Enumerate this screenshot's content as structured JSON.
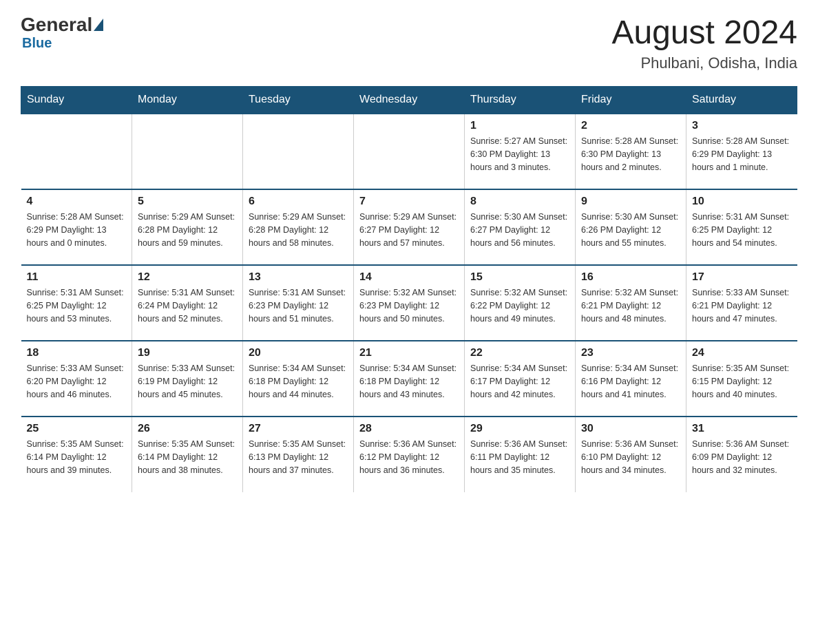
{
  "header": {
    "logo_general": "General",
    "logo_blue": "Blue",
    "month_title": "August 2024",
    "location": "Phulbani, Odisha, India"
  },
  "days_of_week": [
    "Sunday",
    "Monday",
    "Tuesday",
    "Wednesday",
    "Thursday",
    "Friday",
    "Saturday"
  ],
  "weeks": [
    [
      {
        "day": "",
        "info": ""
      },
      {
        "day": "",
        "info": ""
      },
      {
        "day": "",
        "info": ""
      },
      {
        "day": "",
        "info": ""
      },
      {
        "day": "1",
        "info": "Sunrise: 5:27 AM\nSunset: 6:30 PM\nDaylight: 13 hours\nand 3 minutes."
      },
      {
        "day": "2",
        "info": "Sunrise: 5:28 AM\nSunset: 6:30 PM\nDaylight: 13 hours\nand 2 minutes."
      },
      {
        "day": "3",
        "info": "Sunrise: 5:28 AM\nSunset: 6:29 PM\nDaylight: 13 hours\nand 1 minute."
      }
    ],
    [
      {
        "day": "4",
        "info": "Sunrise: 5:28 AM\nSunset: 6:29 PM\nDaylight: 13 hours\nand 0 minutes."
      },
      {
        "day": "5",
        "info": "Sunrise: 5:29 AM\nSunset: 6:28 PM\nDaylight: 12 hours\nand 59 minutes."
      },
      {
        "day": "6",
        "info": "Sunrise: 5:29 AM\nSunset: 6:28 PM\nDaylight: 12 hours\nand 58 minutes."
      },
      {
        "day": "7",
        "info": "Sunrise: 5:29 AM\nSunset: 6:27 PM\nDaylight: 12 hours\nand 57 minutes."
      },
      {
        "day": "8",
        "info": "Sunrise: 5:30 AM\nSunset: 6:27 PM\nDaylight: 12 hours\nand 56 minutes."
      },
      {
        "day": "9",
        "info": "Sunrise: 5:30 AM\nSunset: 6:26 PM\nDaylight: 12 hours\nand 55 minutes."
      },
      {
        "day": "10",
        "info": "Sunrise: 5:31 AM\nSunset: 6:25 PM\nDaylight: 12 hours\nand 54 minutes."
      }
    ],
    [
      {
        "day": "11",
        "info": "Sunrise: 5:31 AM\nSunset: 6:25 PM\nDaylight: 12 hours\nand 53 minutes."
      },
      {
        "day": "12",
        "info": "Sunrise: 5:31 AM\nSunset: 6:24 PM\nDaylight: 12 hours\nand 52 minutes."
      },
      {
        "day": "13",
        "info": "Sunrise: 5:31 AM\nSunset: 6:23 PM\nDaylight: 12 hours\nand 51 minutes."
      },
      {
        "day": "14",
        "info": "Sunrise: 5:32 AM\nSunset: 6:23 PM\nDaylight: 12 hours\nand 50 minutes."
      },
      {
        "day": "15",
        "info": "Sunrise: 5:32 AM\nSunset: 6:22 PM\nDaylight: 12 hours\nand 49 minutes."
      },
      {
        "day": "16",
        "info": "Sunrise: 5:32 AM\nSunset: 6:21 PM\nDaylight: 12 hours\nand 48 minutes."
      },
      {
        "day": "17",
        "info": "Sunrise: 5:33 AM\nSunset: 6:21 PM\nDaylight: 12 hours\nand 47 minutes."
      }
    ],
    [
      {
        "day": "18",
        "info": "Sunrise: 5:33 AM\nSunset: 6:20 PM\nDaylight: 12 hours\nand 46 minutes."
      },
      {
        "day": "19",
        "info": "Sunrise: 5:33 AM\nSunset: 6:19 PM\nDaylight: 12 hours\nand 45 minutes."
      },
      {
        "day": "20",
        "info": "Sunrise: 5:34 AM\nSunset: 6:18 PM\nDaylight: 12 hours\nand 44 minutes."
      },
      {
        "day": "21",
        "info": "Sunrise: 5:34 AM\nSunset: 6:18 PM\nDaylight: 12 hours\nand 43 minutes."
      },
      {
        "day": "22",
        "info": "Sunrise: 5:34 AM\nSunset: 6:17 PM\nDaylight: 12 hours\nand 42 minutes."
      },
      {
        "day": "23",
        "info": "Sunrise: 5:34 AM\nSunset: 6:16 PM\nDaylight: 12 hours\nand 41 minutes."
      },
      {
        "day": "24",
        "info": "Sunrise: 5:35 AM\nSunset: 6:15 PM\nDaylight: 12 hours\nand 40 minutes."
      }
    ],
    [
      {
        "day": "25",
        "info": "Sunrise: 5:35 AM\nSunset: 6:14 PM\nDaylight: 12 hours\nand 39 minutes."
      },
      {
        "day": "26",
        "info": "Sunrise: 5:35 AM\nSunset: 6:14 PM\nDaylight: 12 hours\nand 38 minutes."
      },
      {
        "day": "27",
        "info": "Sunrise: 5:35 AM\nSunset: 6:13 PM\nDaylight: 12 hours\nand 37 minutes."
      },
      {
        "day": "28",
        "info": "Sunrise: 5:36 AM\nSunset: 6:12 PM\nDaylight: 12 hours\nand 36 minutes."
      },
      {
        "day": "29",
        "info": "Sunrise: 5:36 AM\nSunset: 6:11 PM\nDaylight: 12 hours\nand 35 minutes."
      },
      {
        "day": "30",
        "info": "Sunrise: 5:36 AM\nSunset: 6:10 PM\nDaylight: 12 hours\nand 34 minutes."
      },
      {
        "day": "31",
        "info": "Sunrise: 5:36 AM\nSunset: 6:09 PM\nDaylight: 12 hours\nand 32 minutes."
      }
    ]
  ]
}
